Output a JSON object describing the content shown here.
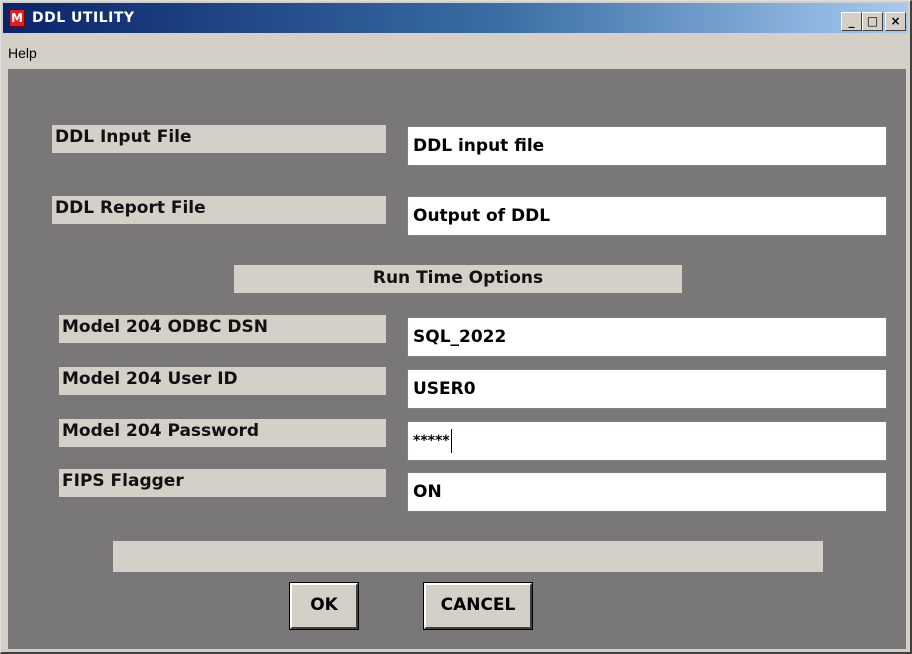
{
  "window": {
    "title": "DDL UTILITY",
    "app_icon": "app-icon",
    "controls": {
      "minimize": "_",
      "maximize": "□",
      "close": "×"
    }
  },
  "menu": {
    "items": [
      {
        "label": "Help"
      }
    ]
  },
  "form": {
    "ddl_input_file": {
      "label": "DDL Input File",
      "value": "DDL input file"
    },
    "ddl_report_file": {
      "label": "DDL Report File",
      "value": "Output of DDL"
    },
    "section_title": "Run Time Options",
    "odbc_dsn": {
      "label": "Model 204 ODBC DSN",
      "value": "SQL_2022"
    },
    "user_id": {
      "label": "Model 204 User ID",
      "value": "USER0"
    },
    "password": {
      "label": "Model 204 Password",
      "value": "*****"
    },
    "fips_flagger": {
      "label": "FIPS Flagger",
      "value": "ON"
    },
    "status_text": ""
  },
  "buttons": {
    "ok": "OK",
    "cancel": "CANCEL"
  },
  "colors": {
    "client_bg": "#7a7778",
    "panel": "#d4d0c8",
    "title_start": "#0a246a",
    "title_end": "#a6caf0"
  }
}
